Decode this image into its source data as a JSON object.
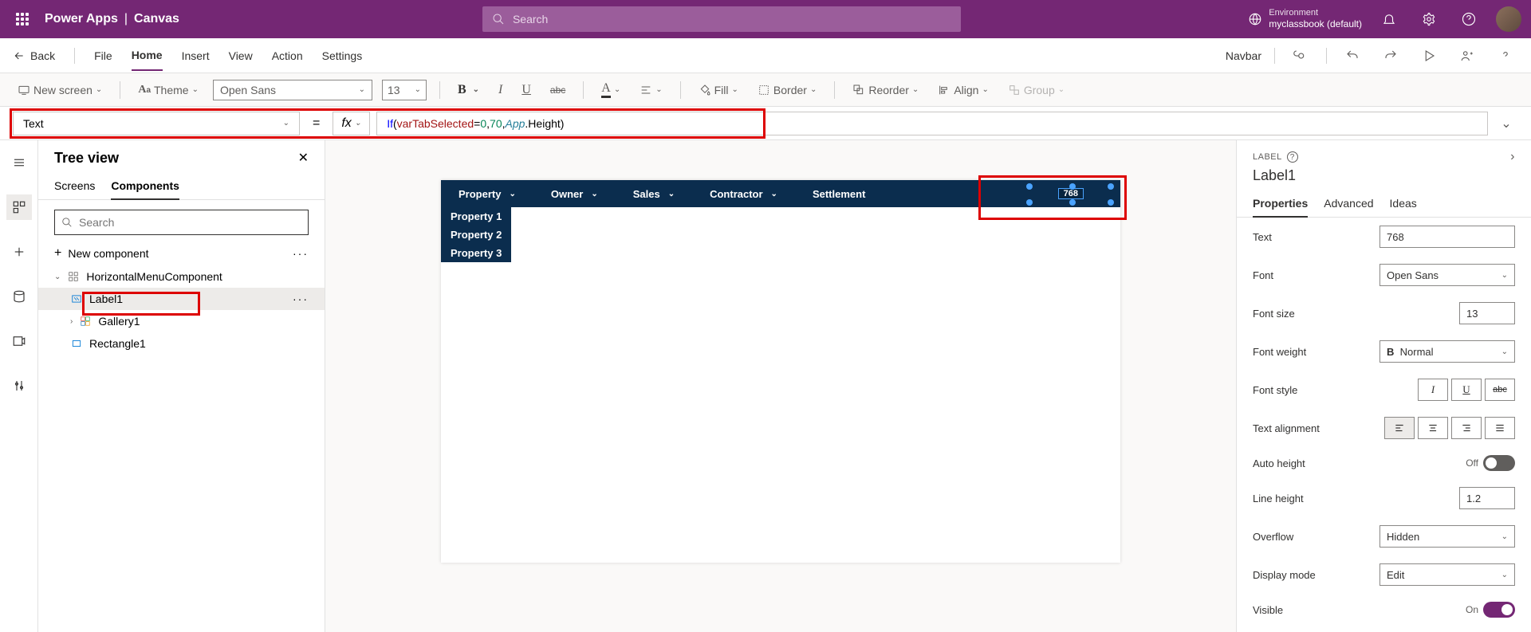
{
  "topbar": {
    "app_name": "Power Apps",
    "sub_title": "Canvas",
    "search_placeholder": "Search",
    "env_label": "Environment",
    "env_value": "myclassbook (default)"
  },
  "menubar": {
    "back": "Back",
    "items": [
      "File",
      "Home",
      "Insert",
      "View",
      "Action",
      "Settings"
    ],
    "navbar_label": "Navbar"
  },
  "toolbar": {
    "new_screen": "New screen",
    "theme": "Theme",
    "font": "Open Sans",
    "font_size": "13",
    "fill": "Fill",
    "border": "Border",
    "reorder": "Reorder",
    "align": "Align",
    "group": "Group"
  },
  "formula": {
    "property": "Text",
    "fx": "fx",
    "kw_if": "If",
    "var": "varTabSelected",
    "eq": " = ",
    "n0": "0",
    "n70": "70",
    "obj": "App",
    "height": ".Height)"
  },
  "tree": {
    "title": "Tree view",
    "tabs": [
      "Screens",
      "Components"
    ],
    "search_placeholder": "Search",
    "new_component": "New component",
    "nodes": {
      "root": "HorizontalMenuComponent",
      "label1": "Label1",
      "gallery1": "Gallery1",
      "rect1": "Rectangle1"
    }
  },
  "canvas": {
    "menu": [
      "Property",
      "Owner",
      "Sales",
      "Contractor",
      "Settlement"
    ],
    "dropdown": [
      "Property 1",
      "Property 2",
      "Property 3"
    ],
    "selected_label": "768"
  },
  "props": {
    "type_label": "LABEL",
    "name": "Label1",
    "tabs": [
      "Properties",
      "Advanced",
      "Ideas"
    ],
    "text_label": "Text",
    "text_value": "768",
    "font_label": "Font",
    "font_value": "Open Sans",
    "fontsize_label": "Font size",
    "fontsize_value": "13",
    "fontweight_label": "Font weight",
    "fontweight_value": "Normal",
    "fontstyle_label": "Font style",
    "textalign_label": "Text alignment",
    "autoheight_label": "Auto height",
    "autoheight_value": "Off",
    "lineheight_label": "Line height",
    "lineheight_value": "1.2",
    "overflow_label": "Overflow",
    "overflow_value": "Hidden",
    "displaymode_label": "Display mode",
    "displaymode_value": "Edit",
    "visible_label": "Visible",
    "visible_value": "On"
  }
}
